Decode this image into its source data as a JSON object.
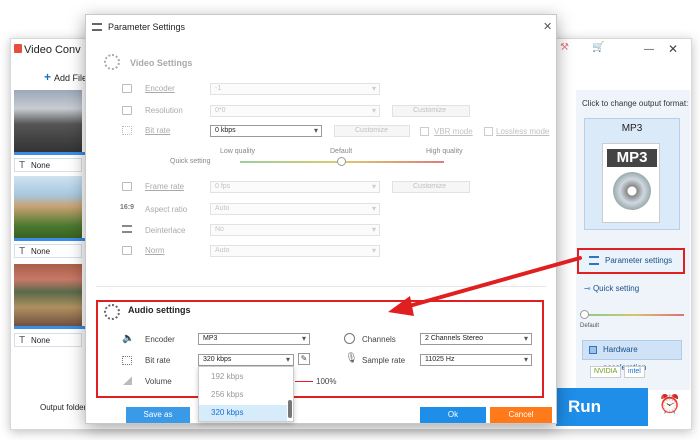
{
  "main": {
    "title": "Video Conv",
    "add_file": "Add File",
    "thumbnails": [
      {
        "subtitle": "None"
      },
      {
        "subtitle": "None"
      },
      {
        "subtitle": "None"
      }
    ],
    "output_folder": "Output folder:",
    "run": "Run"
  },
  "right_panel": {
    "click_label": "Click to change output format:",
    "format": "MP3",
    "format_icon_label": "MP3",
    "parameter_settings": "Parameter settings",
    "quick_setting": "Quick setting",
    "quick_default": "Default",
    "hardware_acceleration": "Hardware acceleration",
    "chips": [
      "NVIDIA",
      "intel"
    ]
  },
  "dialog": {
    "title": "Parameter Settings",
    "video": {
      "section": "Video Settings",
      "encoder": {
        "label": "Encoder",
        "value": "-1"
      },
      "resolution": {
        "label": "Resolution",
        "value": "0*0",
        "customize": "Customize"
      },
      "bitrate": {
        "label": "Bit rate",
        "value": "0 kbps",
        "customize": "Customize",
        "vbr": "VBR mode",
        "lossless": "Lossless mode"
      },
      "quick": {
        "label": "Quick setting",
        "low": "Low quality",
        "default": "Default",
        "high": "High quality"
      },
      "framerate": {
        "label": "Frame rate",
        "value": "0 fps",
        "customize": "Customize"
      },
      "aspect": {
        "label": "Aspect ratio",
        "value": "Auto"
      },
      "deinterlace": {
        "label": "Deinterlace",
        "value": "No"
      },
      "norm": {
        "label": "Norm",
        "value": "Auto"
      }
    },
    "audio": {
      "section": "Audio settings",
      "encoder": {
        "label": "Encoder",
        "value": "MP3"
      },
      "channels": {
        "label": "Channels",
        "value": "2 Channels Stereo"
      },
      "bitrate": {
        "label": "Bit rate",
        "value": "320 kbps"
      },
      "samplerate": {
        "label": "Sample rate",
        "value": "11025 Hz"
      },
      "volume": {
        "label": "Volume",
        "value": "100%"
      },
      "bitrate_options": [
        "192 kbps",
        "256 kbps",
        "320 kbps"
      ]
    },
    "save_as": "Save as",
    "ok": "Ok",
    "cancel": "Cancel"
  },
  "colors": {
    "accent": "#1e8ee8",
    "highlight": "#e02020",
    "cancel": "#ff7a1a"
  }
}
